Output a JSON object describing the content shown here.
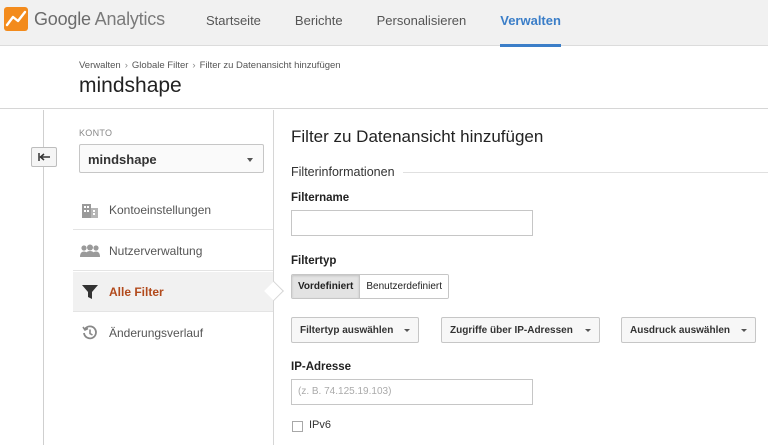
{
  "app": {
    "logo_google": "Google",
    "logo_product": "Analytics"
  },
  "nav": {
    "items": [
      {
        "label": "Startseite"
      },
      {
        "label": "Berichte"
      },
      {
        "label": "Personalisieren"
      },
      {
        "label": "Verwalten",
        "active": true
      }
    ]
  },
  "breadcrumb": {
    "items": [
      "Verwalten",
      "Globale Filter",
      "Filter zu Datenansicht hinzufügen"
    ],
    "separator": "›"
  },
  "page_title": "mindshape",
  "sidebar": {
    "account_label": "KONTO",
    "account_value": "mindshape",
    "items": [
      {
        "label": "Kontoeinstellungen",
        "icon": "building-icon"
      },
      {
        "label": "Nutzerverwaltung",
        "icon": "users-icon"
      },
      {
        "label": "Alle Filter",
        "icon": "filter-icon",
        "active": true
      },
      {
        "label": "Änderungsverlauf",
        "icon": "history-icon"
      }
    ]
  },
  "main": {
    "title": "Filter zu Datenansicht hinzufügen",
    "section_title": "Filterinformationen",
    "filter_name_label": "Filtername",
    "filter_name_value": "",
    "filter_type_label": "Filtertyp",
    "filter_type_options": [
      "Vordefiniert",
      "Benutzerdefiniert"
    ],
    "filter_type_selected": "Vordefiniert",
    "dropdowns": {
      "filter_type": "Filtertyp auswählen",
      "traffic": "Zugriffe über IP-Adressen",
      "expression": "Ausdruck auswählen"
    },
    "ip_label": "IP-Adresse",
    "ip_placeholder": "(z. B. 74.125.19.103)",
    "ipv6_label": "IPv6",
    "ipv6_checked": false
  },
  "colors": {
    "accent": "#3b7ec8",
    "active_sidebar_text": "#b24a1c",
    "logo_orange": "#f38b1c"
  }
}
